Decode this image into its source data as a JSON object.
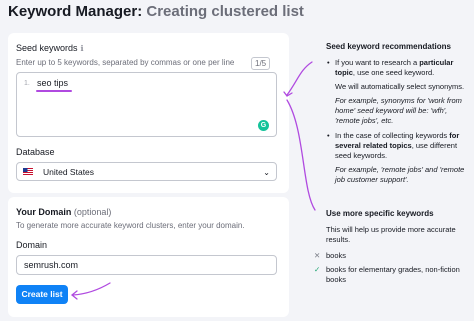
{
  "header": {
    "title_strong": "Keyword Manager:",
    "title_light": "Creating clustered list"
  },
  "seed_card": {
    "label": "Seed keywords",
    "info_icon": "info-icon",
    "hint": "Enter up to 5 keywords, separated by commas or one per line",
    "counter": "1/5",
    "line_number": "1.",
    "keyword_value": "seo tips",
    "database_label": "Database",
    "database_value": "United States"
  },
  "domain_card": {
    "title": "Your Domain",
    "optional": "(optional)",
    "hint": "To generate more accurate keyword clusters, enter your domain.",
    "domain_label": "Domain",
    "domain_value": "semrush.com",
    "create_button": "Create list"
  },
  "aside": {
    "rec_title": "Seed keyword recommendations",
    "b1_pre": "If you want to research a ",
    "b1_bold": "particular topic",
    "b1_post": ", use one seed keyword.",
    "b1_sub": "We will automatically select synonyms.",
    "b1_example": "For example, synonyms for 'work from home' seed keyword will be: 'wfh', 'remote jobs', etc.",
    "b2_pre": "In the case of collecting keywords ",
    "b2_bold": "for several related topics",
    "b2_post": ", use different seed keywords.",
    "b2_example": "For example, 'remote jobs' and 'remote job customer support'.",
    "spec_title": "Use more specific keywords",
    "spec_sub": "This will help us provide more accurate results.",
    "bad_example": "books",
    "good_example": "books for elementary grades, non-fiction books"
  },
  "colors": {
    "accent": "#0f82f6",
    "arrow": "#b04ae0",
    "grammarly": "#15c39a",
    "check": "#1ca36f"
  }
}
